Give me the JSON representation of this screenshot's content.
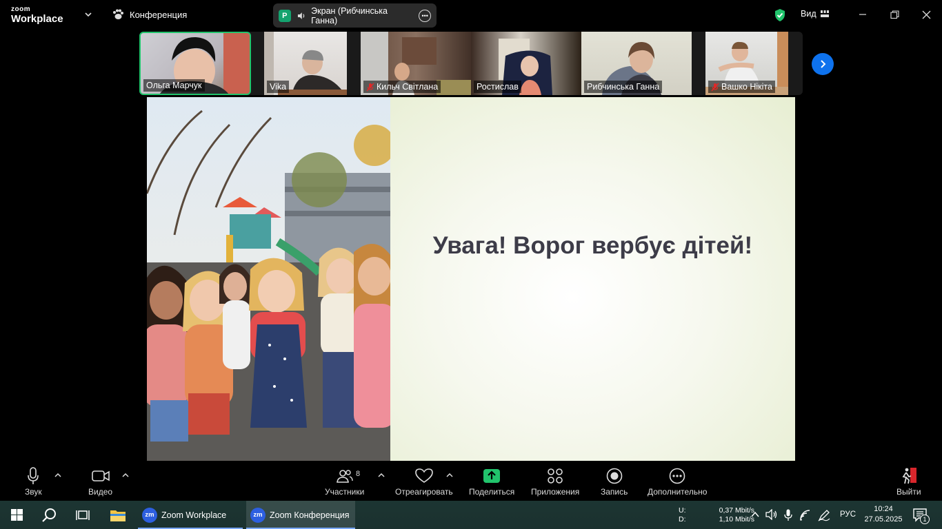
{
  "app": {
    "logo_top": "zoom",
    "logo_bottom": "Workplace",
    "meeting_title": "Конференция",
    "screen_badge": "P",
    "screen_label": "Экран (Рибчинська Ганна)",
    "view_label": "Вид"
  },
  "participants": [
    {
      "name": "Ольга Марчук",
      "muted": false
    },
    {
      "name": "Vika",
      "muted": false
    },
    {
      "name": "Кильч  Світлана",
      "muted": true
    },
    {
      "name": "Ростислав",
      "muted": false
    },
    {
      "name": "Рибчинська Ганна",
      "muted": false
    },
    {
      "name": "Вашко Нікіта",
      "muted": true
    }
  ],
  "slide": {
    "title": "Увага! Ворог вербує дітей!"
  },
  "toolbar": {
    "audio": "Звук",
    "video": "Видео",
    "participants": "Участники",
    "participants_count": "8",
    "react": "Отреагировать",
    "share": "Поделиться",
    "apps": "Приложения",
    "record": "Запись",
    "more": "Дополнительно",
    "leave": "Выйти"
  },
  "taskbar": {
    "apps": [
      {
        "label": "Zoom Workplace",
        "icon": "zm"
      },
      {
        "label": "Zoom Конференция",
        "icon": "zm"
      }
    ],
    "net_u_label": "U:",
    "net_d_label": "D:",
    "net_u_value": "0,37 Mbit/s",
    "net_d_value": "1,10 Mbit/s",
    "lang": "РУС",
    "time": "10:24",
    "date": "27.05.2025",
    "notif_count": "1"
  },
  "colors": {
    "accent_blue": "#0e72ed",
    "share_green": "#21c46c",
    "slide_title": "#3d3c48"
  }
}
